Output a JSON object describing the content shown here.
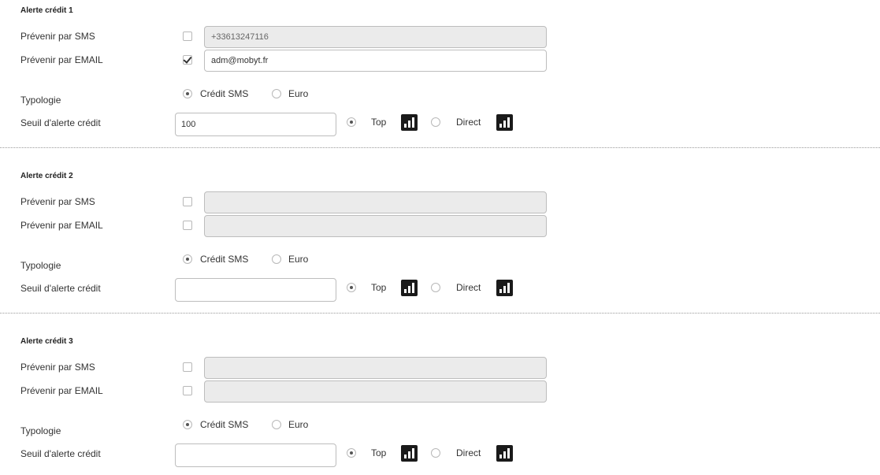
{
  "alerts": [
    {
      "title": "Alerte crédit 1",
      "sms_label": "Prévenir par SMS",
      "sms_checked": false,
      "sms_value": "+33613247116",
      "email_label": "Prévenir par EMAIL",
      "email_checked": true,
      "email_value": "adm@mobyt.fr",
      "typology_label": "Typologie",
      "typology_options": [
        "Crédit SMS",
        "Euro"
      ],
      "typology_selected": "Crédit SMS",
      "threshold_label": "Seuil d'alerte crédit",
      "threshold_value": "100",
      "route_options": [
        "Top",
        "Direct"
      ],
      "route_selected": "Top"
    },
    {
      "title": "Alerte crédit 2",
      "sms_label": "Prévenir par SMS",
      "sms_checked": false,
      "sms_value": "",
      "email_label": "Prévenir par EMAIL",
      "email_checked": false,
      "email_value": "",
      "typology_label": "Typologie",
      "typology_options": [
        "Crédit SMS",
        "Euro"
      ],
      "typology_selected": "Crédit SMS",
      "threshold_label": "Seuil d'alerte crédit",
      "threshold_value": "",
      "route_options": [
        "Top",
        "Direct"
      ],
      "route_selected": "Top"
    },
    {
      "title": "Alerte crédit 3",
      "sms_label": "Prévenir par SMS",
      "sms_checked": false,
      "sms_value": "",
      "email_label": "Prévenir par EMAIL",
      "email_checked": false,
      "email_value": "",
      "typology_label": "Typologie",
      "typology_options": [
        "Crédit SMS",
        "Euro"
      ],
      "typology_selected": "Crédit SMS",
      "threshold_label": "Seuil d'alerte crédit",
      "threshold_value": "",
      "route_options": [
        "Top",
        "Direct"
      ],
      "route_selected": "Top"
    }
  ],
  "icons": {
    "route_icon": "signal-bars-icon"
  },
  "colors": {
    "input_disabled_bg": "#ebebeb",
    "icon_bg": "#1a1a1a"
  }
}
